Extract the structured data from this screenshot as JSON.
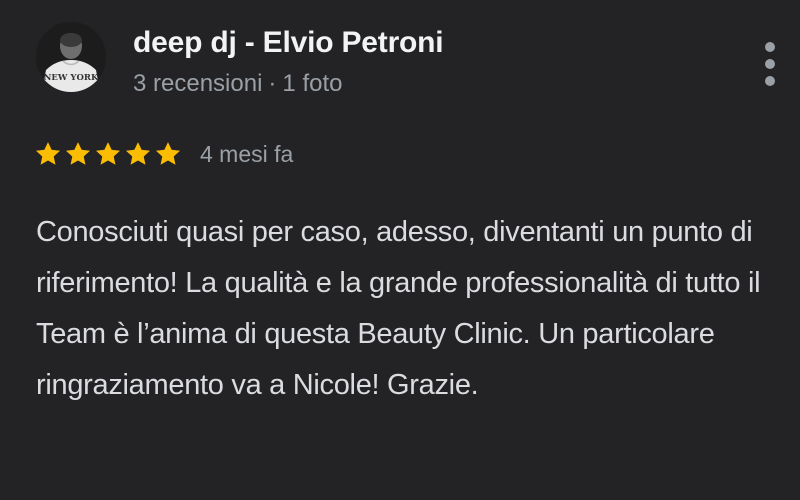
{
  "review": {
    "reviewer_name": "deep dj - Elvio Petroni",
    "reviews_count": "3 recensioni",
    "separator": "·",
    "photos_count": "1 foto",
    "rating": 5,
    "rating_max": 5,
    "date": "4 mesi fa",
    "text": "Conosciuti quasi per caso, adesso, diventanti un punto di riferimento! La qualità e la grande professionalità di tutto il Team è l’anima di questa Beauty Clinic. Un particolare ringraziamento va a Nicole! Grazie.",
    "avatar_text": "NEW YORK"
  },
  "colors": {
    "background": "#232325",
    "star": "#fbbc04",
    "muted_text": "#9aa0a6",
    "primary_text": "#f1f3f4"
  },
  "icons": {
    "more": "more-vert-icon",
    "star": "star-icon"
  }
}
